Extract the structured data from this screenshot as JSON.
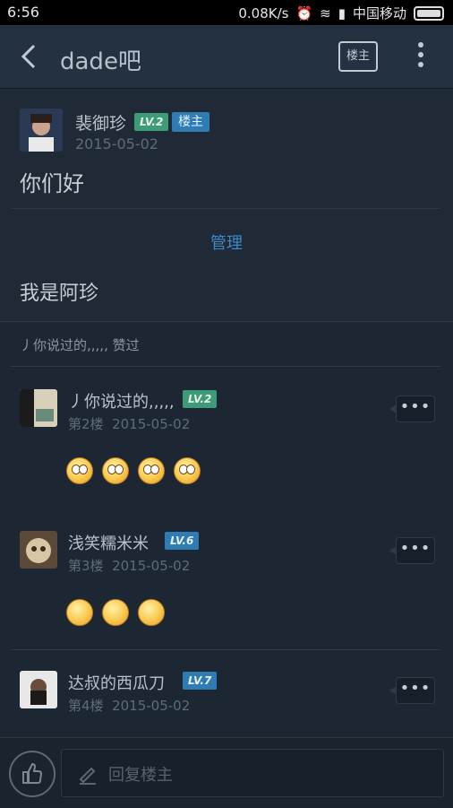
{
  "status_bar": {
    "time": "6:56",
    "net_speed": "0.08K/s",
    "carrier": "中国移动"
  },
  "header": {
    "title": "dade吧",
    "host_button": "楼主"
  },
  "op": {
    "username": "裴御珍",
    "level": "LV.2",
    "host_badge": "楼主",
    "date": "2015-05-02",
    "text": "你们好",
    "manage_label": "管理",
    "text2": "我是阿珍"
  },
  "thread_title": "丿你说过的,,,,, 赞过",
  "replies": [
    {
      "username": "丿你说过的,,,,,",
      "level": "LV.2",
      "floor": "第2楼",
      "date": "2015-05-02",
      "emoji": [
        "shocked-face",
        "shocked-face",
        "shocked-face",
        "shocked-face"
      ]
    },
    {
      "username": "浅笑糯米米",
      "level": "LV.6",
      "floor": "第3楼",
      "date": "2015-05-02",
      "emoji": [
        "smile-face",
        "smile-face",
        "smile-face"
      ]
    },
    {
      "username": "达叔的西瓜刀",
      "level": "LV.7",
      "floor": "第4楼",
      "date": "2015-05-02",
      "emoji": []
    }
  ],
  "bottom": {
    "reply_placeholder": "回复楼主"
  },
  "colors": {
    "background": "#1d2733",
    "header": "#243140",
    "accent_blue": "#3f89c9",
    "level_green": "#3e9b78",
    "level_teal": "#2f7cb5"
  }
}
